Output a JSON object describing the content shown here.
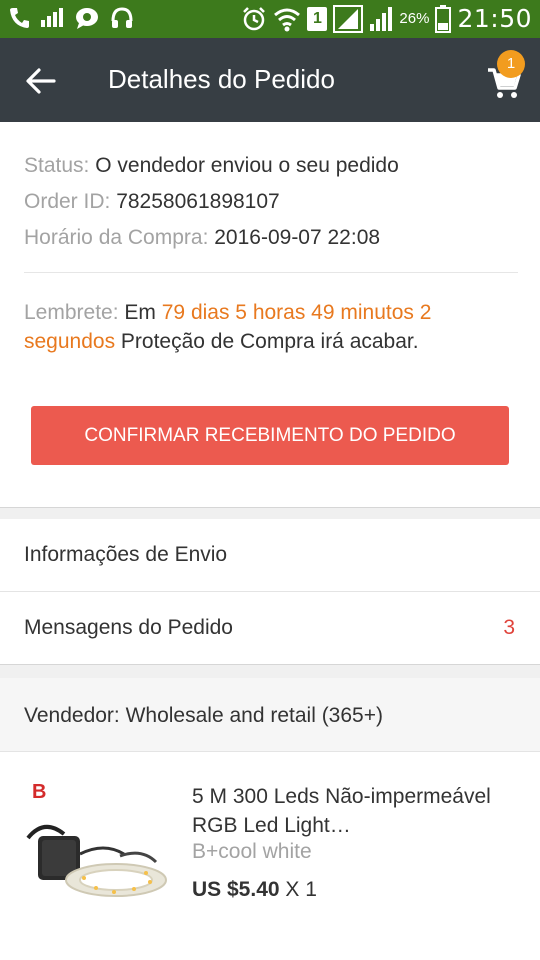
{
  "statusbar": {
    "time": "21:50",
    "battery_pct": "26%",
    "sim": "1"
  },
  "appbar": {
    "title": "Detalhes do Pedido",
    "cart_badge": "1"
  },
  "order": {
    "status_label": "Status:",
    "status_value": "O vendedor enviou o seu pedido",
    "id_label": "Order ID:",
    "id_value": "78258061898107",
    "time_label": "Horário da Compra:",
    "time_value": "2016-09-07 22:08"
  },
  "reminder": {
    "label": "Lembrete:",
    "pre": "Em",
    "countdown_line1": "79 dias 5 horas 49 minutos 2",
    "countdown_line2": "segundos",
    "post": "Proteção de Compra irá acabar."
  },
  "confirm_button": "CONFIRMAR RECEBIMENTO DO PEDIDO",
  "rows": {
    "shipping_info": "Informações de Envio",
    "order_messages": "Mensagens do Pedido",
    "order_messages_count": "3"
  },
  "seller": {
    "text": "Vendedor: Wholesale and retail (365+)"
  },
  "product": {
    "thumb_letter": "B",
    "title": "5 M 300 Leds Não-impermeável RGB Led Light…",
    "variant": "B+cool white",
    "price": "US $5.40",
    "quantity": "X 1"
  },
  "colors": {
    "statusbar": "#3d7a1c",
    "appbar": "#373e44",
    "accent_orange": "#e8791f",
    "button_red": "#ec5a4f",
    "badge": "#f29c1f"
  }
}
